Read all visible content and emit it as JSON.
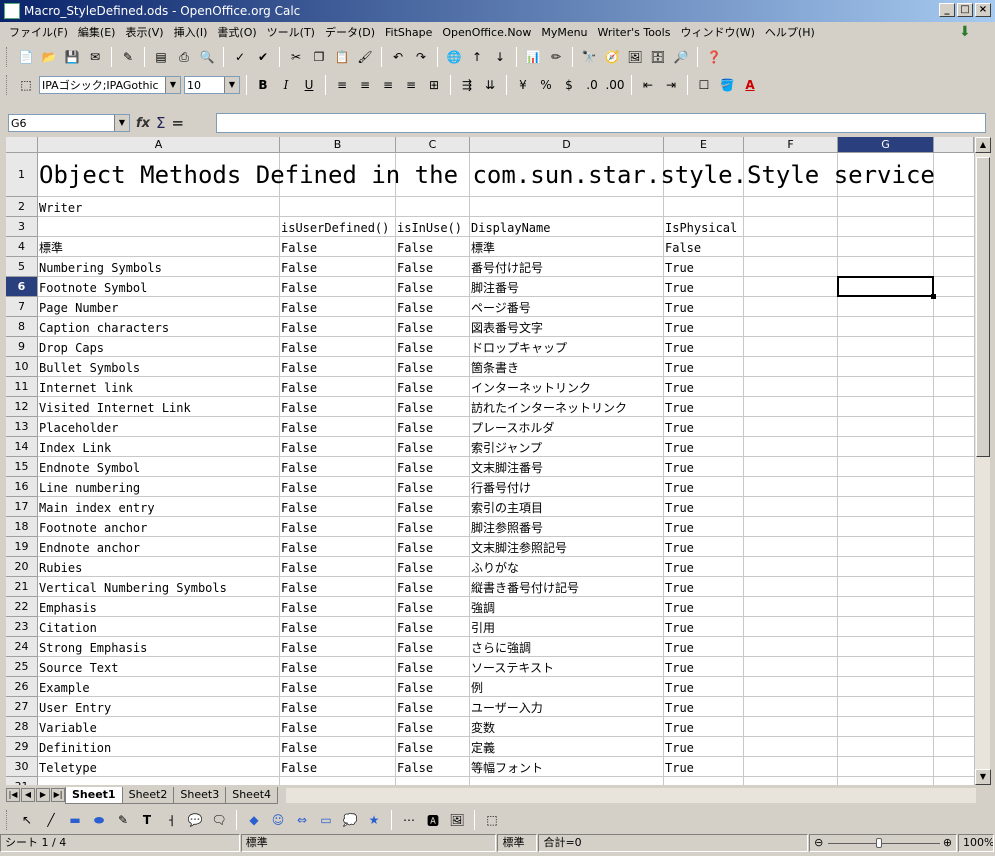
{
  "window": {
    "title": "Macro_StyleDefined.ods - OpenOffice.org Calc"
  },
  "menu": [
    "ファイル(F)",
    "編集(E)",
    "表示(V)",
    "挿入(I)",
    "書式(O)",
    "ツール(T)",
    "データ(D)",
    "FitShape",
    "OpenOffice.Now",
    "MyMenu",
    "Writer's Tools",
    "ウィンドウ(W)",
    "ヘルプ(H)"
  ],
  "format": {
    "font_name": "IPAゴシック;IPAGothic",
    "font_size": "10"
  },
  "formula": {
    "cell_ref": "G6",
    "value": ""
  },
  "columns": [
    "A",
    "B",
    "C",
    "D",
    "E",
    "F",
    "G"
  ],
  "selected": {
    "col": "G",
    "row": "6"
  },
  "sheet": {
    "title": "Object Methods Defined in the com.sun.star.style.Style service",
    "subtitle": "Writer",
    "headers": [
      "isUserDefined()",
      "isInUse()",
      "DisplayName",
      "IsPhysical"
    ],
    "rows": [
      [
        "標準",
        "False",
        "False",
        "標準",
        "False"
      ],
      [
        "Numbering Symbols",
        "False",
        "False",
        "番号付け記号",
        "True"
      ],
      [
        "Footnote Symbol",
        "False",
        "False",
        "脚注番号",
        "True"
      ],
      [
        "Page Number",
        "False",
        "False",
        "ページ番号",
        "True"
      ],
      [
        "Caption characters",
        "False",
        "False",
        "図表番号文字",
        "True"
      ],
      [
        "Drop Caps",
        "False",
        "False",
        "ドロップキャップ",
        "True"
      ],
      [
        "Bullet Symbols",
        "False",
        "False",
        "箇条書き",
        "True"
      ],
      [
        "Internet link",
        "False",
        "False",
        "インターネットリンク",
        "True"
      ],
      [
        "Visited Internet Link",
        "False",
        "False",
        "訪れたインターネットリンク",
        "True"
      ],
      [
        "Placeholder",
        "False",
        "False",
        "プレースホルダ",
        "True"
      ],
      [
        "Index Link",
        "False",
        "False",
        "索引ジャンプ",
        "True"
      ],
      [
        "Endnote Symbol",
        "False",
        "False",
        "文末脚注番号",
        "True"
      ],
      [
        "Line numbering",
        "False",
        "False",
        "行番号付け",
        "True"
      ],
      [
        "Main index entry",
        "False",
        "False",
        "索引の主項目",
        "True"
      ],
      [
        "Footnote anchor",
        "False",
        "False",
        "脚注参照番号",
        "True"
      ],
      [
        "Endnote anchor",
        "False",
        "False",
        "文末脚注参照記号",
        "True"
      ],
      [
        "Rubies",
        "False",
        "False",
        "ふりがな",
        "True"
      ],
      [
        "Vertical Numbering Symbols",
        "False",
        "False",
        "縦書き番号付け記号",
        "True"
      ],
      [
        "Emphasis",
        "False",
        "False",
        "強調",
        "True"
      ],
      [
        "Citation",
        "False",
        "False",
        "引用",
        "True"
      ],
      [
        "Strong Emphasis",
        "False",
        "False",
        "さらに強調",
        "True"
      ],
      [
        "Source Text",
        "False",
        "False",
        "ソーステキスト",
        "True"
      ],
      [
        "Example",
        "False",
        "False",
        "例",
        "True"
      ],
      [
        "User Entry",
        "False",
        "False",
        "ユーザー入力",
        "True"
      ],
      [
        "Variable",
        "False",
        "False",
        "変数",
        "True"
      ],
      [
        "Definition",
        "False",
        "False",
        "定義",
        "True"
      ],
      [
        "Teletype",
        "False",
        "False",
        "等幅フォント",
        "True"
      ]
    ]
  },
  "tabs": [
    "Sheet1",
    "Sheet2",
    "Sheet3",
    "Sheet4"
  ],
  "active_tab": "Sheet1",
  "status": {
    "sheet": "シート 1 / 4",
    "style": "標準",
    "mode": "標準",
    "sum": "合計=0",
    "zoom": "100%"
  }
}
